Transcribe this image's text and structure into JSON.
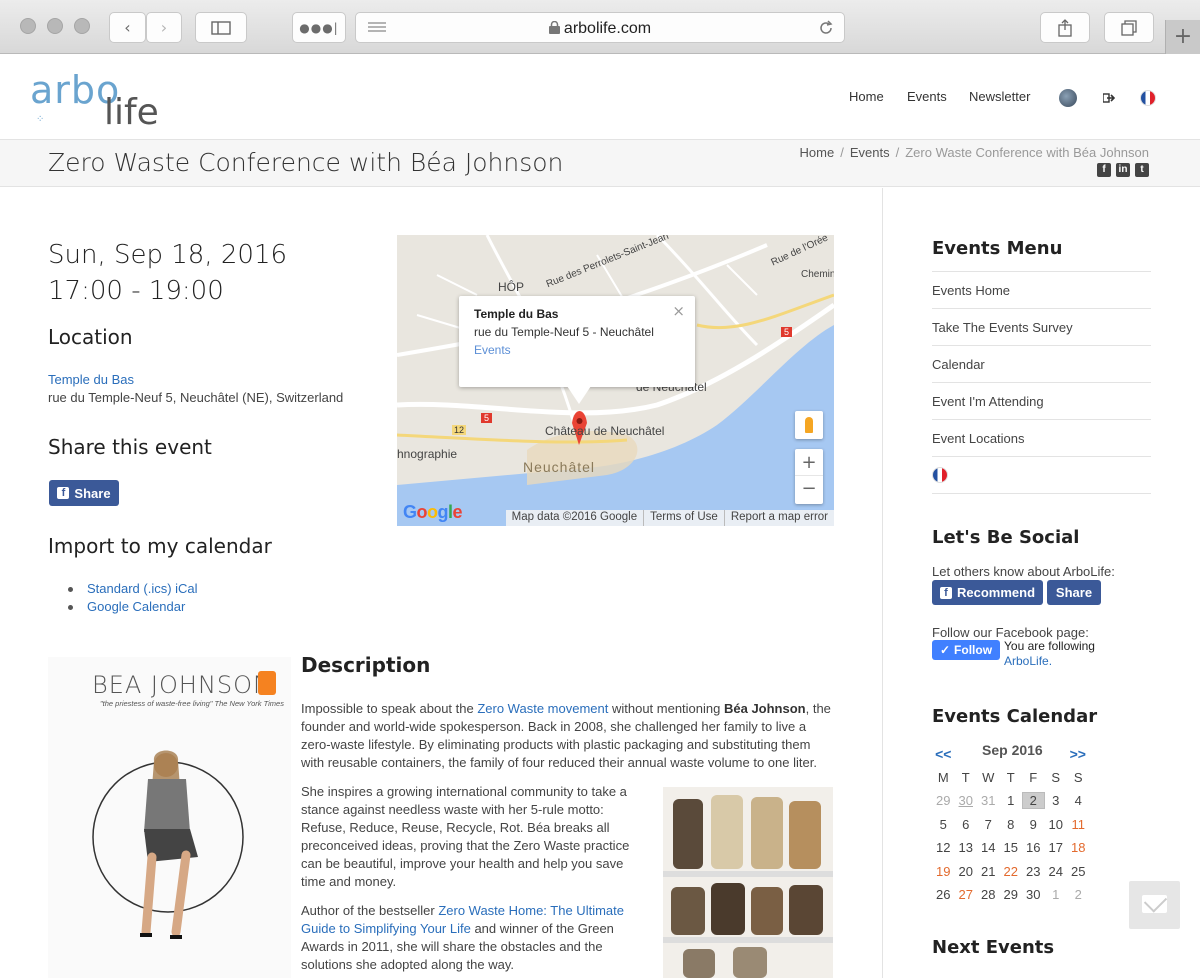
{
  "browser": {
    "url": "arbolife.com"
  },
  "header": {
    "logo_arbo": "arbo",
    "logo_life": "life",
    "nav": [
      "Home",
      "Events",
      "Newsletter"
    ]
  },
  "titlebar": {
    "title": "Zero Waste Conference with Béa Johnson",
    "breadcrumb": [
      "Home",
      "Events",
      "Zero Waste Conference with Béa Johnson"
    ]
  },
  "event": {
    "date": "Sun, Sep 18, 2016",
    "time": "17:00 - 19:00",
    "location_heading": "Location",
    "location_name": "Temple du Bas",
    "location_address": "rue du Temple-Neuf 5, Neuchâtel (NE), Switzerland",
    "share_heading": "Share this event",
    "share_button": "Share",
    "import_heading": "Import to my calendar",
    "import_links": [
      "Standard (.ics) iCal",
      "Google Calendar"
    ]
  },
  "map": {
    "info_title": "Temple du Bas",
    "info_address": "rue du Temple-Neuf 5 - Neuchâtel",
    "info_link": "Events",
    "labels": {
      "hop": "HÔP",
      "perrolets": "Rue des Perrolets-Saint-Jean",
      "oree": "Rue de l'Orée",
      "chemin": "Chemin",
      "de_neuchatel": "de Neuchâtel",
      "chateau": "Château de Neuchâtel",
      "neuchatel": "Neuchâtel",
      "graphie": "hnographie",
      "road5a": "5",
      "road5b": "5",
      "road12": "12"
    },
    "google": "Google",
    "footer": [
      "Map data ©2016 Google",
      "Terms of Use",
      "Report a map error"
    ]
  },
  "description": {
    "heading": "Description",
    "book_author": "BEA JOHNSON",
    "book_quote": "\"the priestess of waste-free living\" The New York Times",
    "p1_a": "Impossible to speak about the ",
    "p1_link": "Zero Waste movement",
    "p1_b": " without mentioning ",
    "p1_bold": "Béa Johnson",
    "p1_c": ", the founder and world-wide spokesperson. Back in 2008, she challenged her family to live a zero-waste lifestyle. By eliminating products with plastic packaging and substituting them with reusable containers, the family of four reduced their annual waste volume to one liter.",
    "p2": "She inspires a growing international community to take a stance against needless waste with her 5-rule motto: Refuse, Reduce, Reuse, Recycle, Rot. Béa breaks all preconceived ideas, proving that the Zero Waste practice can be beautiful, improve your health and help you save time and money.",
    "p3_a": "Author of the bestseller ",
    "p3_link": "Zero Waste Home: The Ultimate Guide to Simplifying Your Life",
    "p3_b": " and winner of the Green Awards in 2011, she will share the obstacles and the solutions she adopted along the way."
  },
  "sidebar": {
    "events_menu_heading": "Events Menu",
    "menu": [
      "Events Home",
      "Take The Events Survey",
      "Calendar",
      "Event I'm Attending",
      "Event Locations"
    ],
    "social_heading": "Let's Be Social",
    "social_text": "Let others know about ArboLife:",
    "recommend_button": "Recommend",
    "share_button": "Share",
    "follow_text": "Follow our Facebook page:",
    "follow_button": "Follow",
    "following_text": "You are following",
    "following_link": "ArboLife.",
    "calendar_heading": "Events Calendar",
    "next_events_heading": "Next Events"
  },
  "calendar": {
    "prev": "<<",
    "next": ">>",
    "month": "Sep 2016",
    "weekdays": [
      "M",
      "T",
      "W",
      "T",
      "F",
      "S",
      "S"
    ],
    "weeks": [
      [
        "29",
        "30",
        "31",
        "1",
        "2",
        "3",
        "4"
      ],
      [
        "5",
        "6",
        "7",
        "8",
        "9",
        "10",
        "11"
      ],
      [
        "12",
        "13",
        "14",
        "15",
        "16",
        "17",
        "18"
      ],
      [
        "19",
        "20",
        "21",
        "22",
        "23",
        "24",
        "25"
      ],
      [
        "26",
        "27",
        "28",
        "29",
        "30",
        "1",
        "2"
      ]
    ]
  },
  "colors": {
    "link": "#2a6ebb",
    "facebook": "#3b5998",
    "event_day": "#e36a2e",
    "water": "#a6c8f2"
  }
}
